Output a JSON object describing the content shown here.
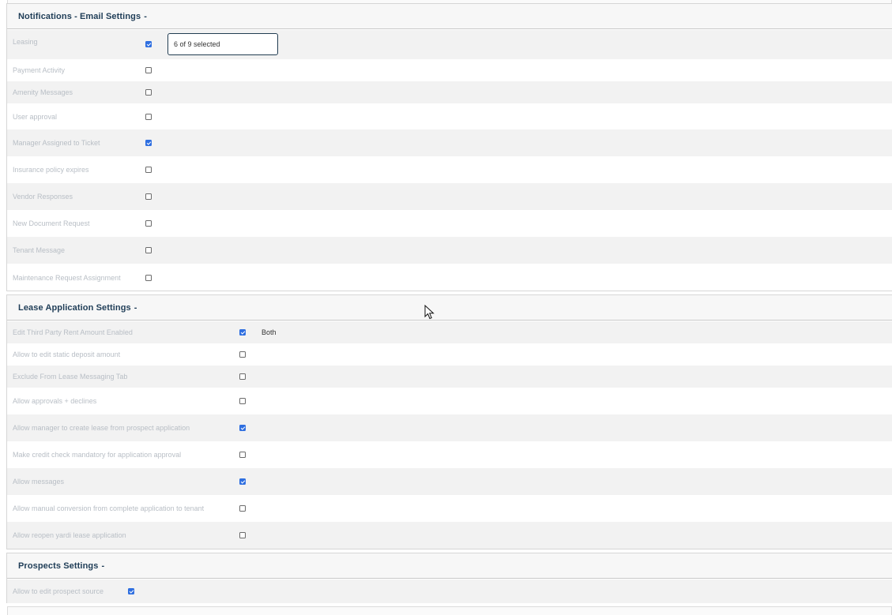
{
  "notifications": {
    "title": "Notifications - Email Settings",
    "toggle": "-",
    "leasing_selector": "6 of 9 selected",
    "rows": [
      {
        "label": "Leasing",
        "checked": true
      },
      {
        "label": "Payment Activity",
        "checked": false
      },
      {
        "label": "Amenity Messages",
        "checked": false
      },
      {
        "label": "User approval",
        "checked": false
      },
      {
        "label": "Manager Assigned to Ticket",
        "checked": true
      },
      {
        "label": "Insurance policy expires",
        "checked": false
      },
      {
        "label": "Vendor Responses",
        "checked": false
      },
      {
        "label": "New Document Request",
        "checked": false
      },
      {
        "label": "Tenant Message",
        "checked": false
      },
      {
        "label": "Maintenance Request Assignment",
        "checked": false
      }
    ]
  },
  "lease_application": {
    "title": "Lease Application Settings",
    "toggle": "-",
    "third_party_value": "Both",
    "rows": [
      {
        "label": "Edit Third Party Rent Amount Enabled",
        "checked": true
      },
      {
        "label": "Allow to edit static deposit amount",
        "checked": false
      },
      {
        "label": "Exclude From Lease Messaging Tab",
        "checked": false
      },
      {
        "label": "Allow approvals + declines",
        "checked": false
      },
      {
        "label": "Allow manager to create lease from prospect application",
        "checked": true
      },
      {
        "label": "Make credit check mandatory for application approval",
        "checked": false
      },
      {
        "label": "Allow messages",
        "checked": true
      },
      {
        "label": "Allow manual conversion from complete application to tenant",
        "checked": false
      },
      {
        "label": "Allow reopen yardi lease application",
        "checked": false
      }
    ]
  },
  "prospects": {
    "title": "Prospects Settings",
    "toggle": "-",
    "rows": [
      {
        "label": "Allow to edit prospect source",
        "checked": true
      }
    ]
  },
  "colors": {
    "header_text": "#1f3d57",
    "label_text": "#b8bec5",
    "checkbox_checked": "#2f6fe0",
    "row_shade": "#f2f2f2"
  }
}
